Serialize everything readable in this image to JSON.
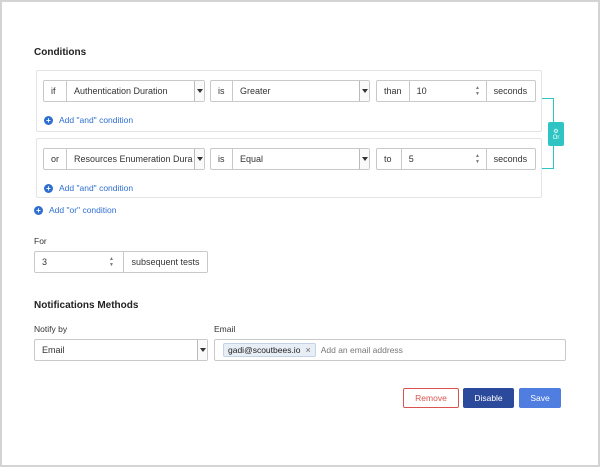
{
  "conditions": {
    "title": "Conditions",
    "group1": {
      "connector": "if",
      "metric": "Authentication Duration",
      "operator_prefix": "is",
      "operator": "Greater",
      "comparator": "than",
      "value": "10",
      "unit": "seconds",
      "add_and": "Add \"and\" condition"
    },
    "group2": {
      "connector": "or",
      "metric": "Resources Enumeration Dura",
      "operator_prefix": "is",
      "operator": "Equal",
      "comparator": "to",
      "value": "5",
      "unit": "seconds",
      "add_and": "Add \"and\" condition"
    },
    "or_badge": "Or",
    "add_or": "Add \"or\" condition"
  },
  "for": {
    "label": "For",
    "value": "3",
    "suffix": "subsequent tests"
  },
  "notifications": {
    "title": "Notifications Methods",
    "notify_label": "Notify by",
    "notify_value": "Email",
    "email_label": "Email",
    "email_tag": "gadi@scoutbees.io",
    "email_placeholder": "Add an email address"
  },
  "actions": {
    "remove": "Remove",
    "disable": "Disable",
    "save": "Save"
  },
  "colors": {
    "link": "#2f6fd1",
    "remove_border": "#d9534f",
    "disable_bg": "#2c4a9c",
    "save_bg": "#4f7de0",
    "or_badge": "#2ec4c4"
  }
}
